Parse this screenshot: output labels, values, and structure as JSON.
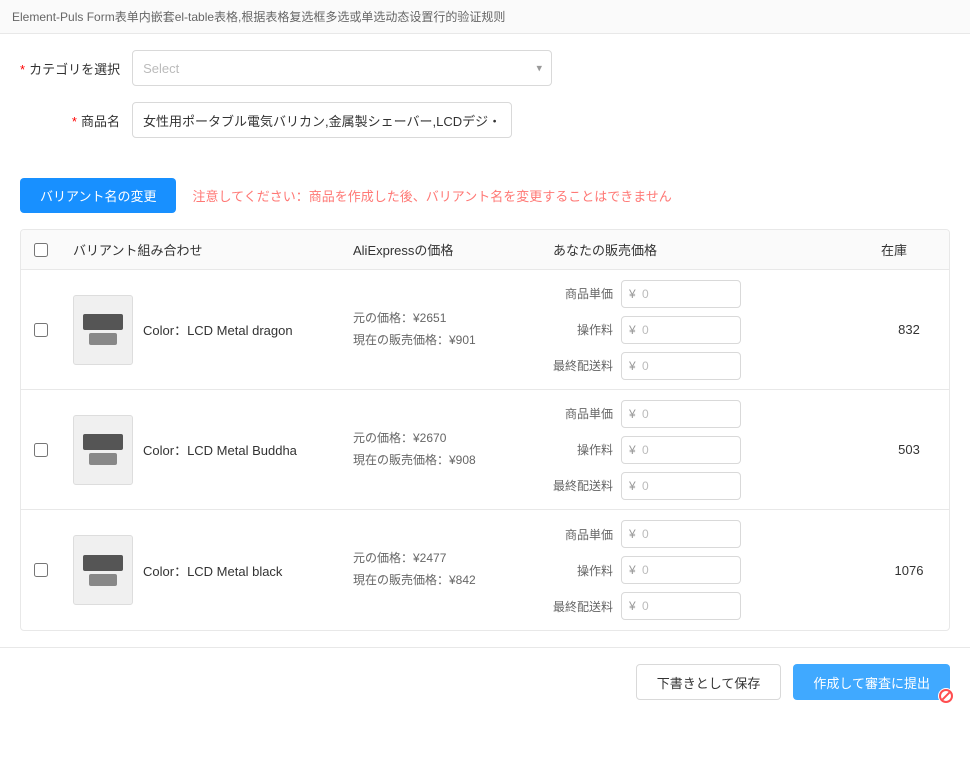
{
  "page": {
    "title": "Element-Puls Form表单内嵌套el-table表格,根据表格复选框多选或单选动态设置行的验证规则"
  },
  "form": {
    "category_label": "カテゴリを選択",
    "category_required": "*",
    "category_placeholder": "Select",
    "product_name_label": "商品名",
    "product_name_required": "*",
    "product_name_value": "女性用ポータブル電気バリカン,金属製シェーバー,LCDデジ・"
  },
  "variant_section": {
    "change_button_label": "バリアント名の変更",
    "warning_prefix": "注意してください：",
    "warning_text": "商品を作成した後、バリアント名を変更することはできません"
  },
  "table": {
    "headers": {
      "variant_combo": "バリアント組み合わせ",
      "aliexpress_price": "AliExpressの価格",
      "your_price": "あなたの販売価格",
      "stock": "在庫"
    },
    "pricing_labels": {
      "unit_price": "商品単価",
      "handling_fee": "操作料",
      "shipping": "最終配送料"
    },
    "rows": [
      {
        "id": "row1",
        "variant_label": "Color：LCD Metal dragon",
        "original_price_label": "元の価格：¥2651",
        "current_price_label": "現在の販売価格：¥901",
        "unit_price": "0",
        "handling_fee": "0",
        "shipping": "0",
        "stock": "832"
      },
      {
        "id": "row2",
        "variant_label": "Color：LCD Metal Buddha",
        "original_price_label": "元の価格：¥2670",
        "current_price_label": "現在の販売価格：¥908",
        "unit_price": "0",
        "handling_fee": "0",
        "shipping": "0",
        "stock": "503"
      },
      {
        "id": "row3",
        "variant_label": "Color：LCD Metal black",
        "original_price_label": "元の価格：¥2477",
        "current_price_label": "現在の販売価格：¥842",
        "unit_price": "0",
        "handling_fee": "0",
        "shipping": "0",
        "stock": "1076"
      }
    ]
  },
  "footer": {
    "save_draft_label": "下書きとして保存",
    "submit_label": "作成して審査に提出"
  },
  "icons": {
    "chevron_down": "▾",
    "yen": "¥"
  }
}
